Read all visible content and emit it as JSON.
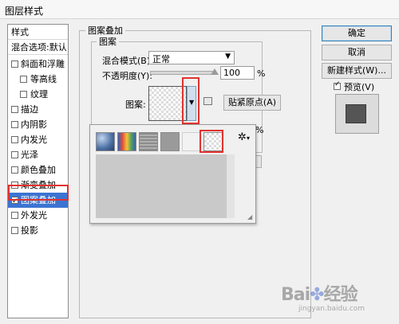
{
  "window": {
    "title": "图层样式"
  },
  "left_panel": {
    "header": "样式",
    "blend_options": "混合选项:默认",
    "items": [
      {
        "label": "斜面和浮雕",
        "checked": false,
        "indent": false
      },
      {
        "label": "等高线",
        "checked": false,
        "indent": true
      },
      {
        "label": "纹理",
        "checked": false,
        "indent": true
      },
      {
        "label": "描边",
        "checked": false,
        "indent": false
      },
      {
        "label": "内阴影",
        "checked": false,
        "indent": false
      },
      {
        "label": "内发光",
        "checked": false,
        "indent": false
      },
      {
        "label": "光泽",
        "checked": false,
        "indent": false
      },
      {
        "label": "颜色叠加",
        "checked": false,
        "indent": false
      },
      {
        "label": "渐变叠加",
        "checked": false,
        "indent": false
      },
      {
        "label": "图案叠加",
        "checked": true,
        "indent": false,
        "selected": true
      },
      {
        "label": "外发光",
        "checked": false,
        "indent": false
      },
      {
        "label": "投影",
        "checked": false,
        "indent": false
      }
    ]
  },
  "main": {
    "group_title": "图案叠加",
    "sub_title": "图案",
    "blend_mode_label": "混合模式(B):",
    "blend_mode_value": "正常",
    "opacity_label": "不透明度(Y):",
    "opacity_value": "100",
    "opacity_unit": "%",
    "pattern_label": "图案:",
    "snap_button": "贴紧原点(A)",
    "hidden_unit": "%"
  },
  "right_panel": {
    "ok": "确定",
    "cancel": "取消",
    "new_style": "新建样式(W)...",
    "preview_label": "预览(V)",
    "preview_checked": true
  },
  "popup": {
    "gear": "✲",
    "gear_arrow": "▾"
  },
  "colors": {
    "selection": "#3c74d2",
    "highlight_box": "#e0322e",
    "preview_swatch": "#555555"
  }
}
